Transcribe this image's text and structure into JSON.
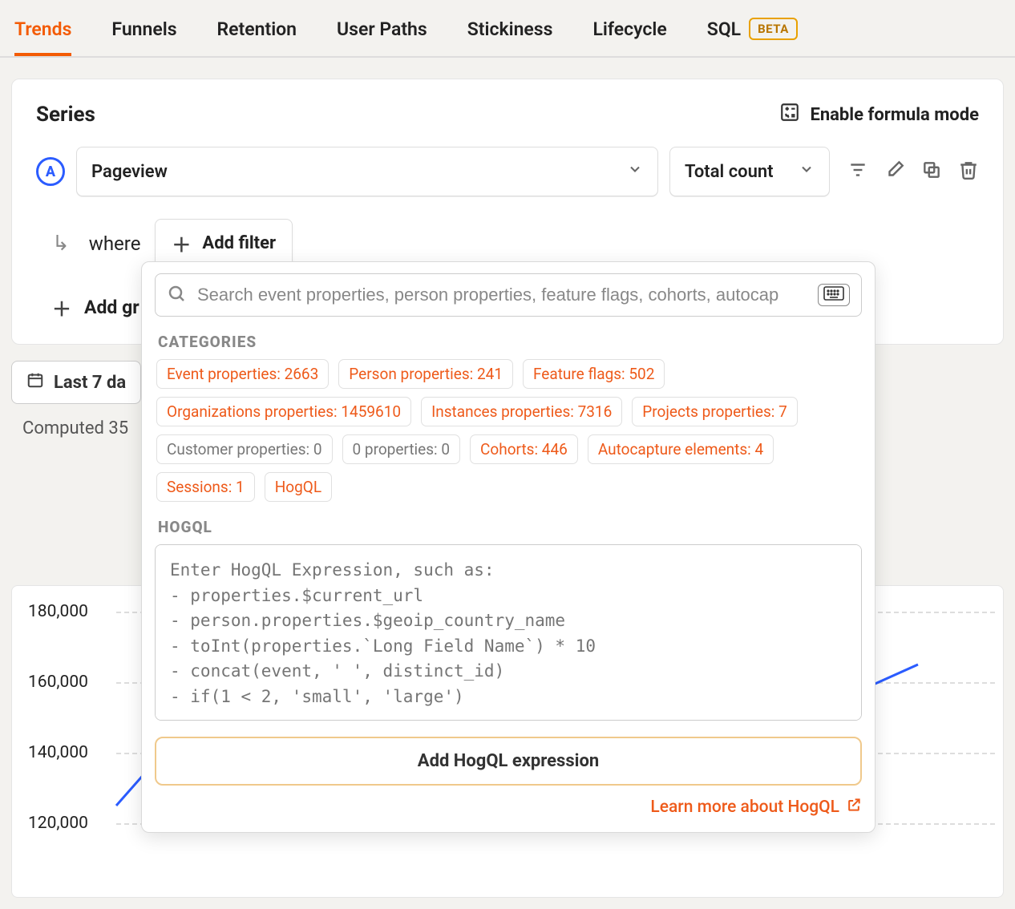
{
  "tabs": {
    "trends": "Trends",
    "funnels": "Funnels",
    "retention": "Retention",
    "user_paths": "User Paths",
    "stickiness": "Stickiness",
    "lifecycle": "Lifecycle",
    "sql": "SQL",
    "beta_badge": "BETA"
  },
  "series": {
    "title": "Series",
    "formula_toggle": "Enable formula mode",
    "badge_letter": "A",
    "event_label": "Pageview",
    "metric_label": "Total count",
    "where_label": "where",
    "add_filter_label": "Add filter",
    "add_graph_label": "Add gr"
  },
  "time": {
    "range_label": "Last 7 da",
    "computed_label": "Computed 35"
  },
  "popover": {
    "search_placeholder": "Search event properties, person properties, feature flags, cohorts, autocap",
    "categories_label": "CATEGORIES",
    "chips": [
      {
        "label": "Event properties: 2663",
        "muted": false
      },
      {
        "label": "Person properties: 241",
        "muted": false
      },
      {
        "label": "Feature flags: 502",
        "muted": false
      },
      {
        "label": "Organizations properties: 1459610",
        "muted": false
      },
      {
        "label": "Instances properties: 7316",
        "muted": false
      },
      {
        "label": "Projects properties: 7",
        "muted": false
      },
      {
        "label": "Customer properties: 0",
        "muted": true
      },
      {
        "label": "0 properties: 0",
        "muted": true
      },
      {
        "label": "Cohorts: 446",
        "muted": false
      },
      {
        "label": "Autocapture elements: 4",
        "muted": false
      },
      {
        "label": "Sessions: 1",
        "muted": false
      },
      {
        "label": "HogQL",
        "muted": false
      }
    ],
    "hogql_label": "HOGQL",
    "hogql_placeholder": "Enter HogQL Expression, such as:\n- properties.$current_url\n- person.properties.$geoip_country_name\n- toInt(properties.`Long Field Name`) * 10\n- concat(event, ' ', distinct_id)\n- if(1 < 2, 'small', 'large')",
    "add_hogql_label": "Add HogQL expression",
    "learn_more_label": "Learn more about HogQL"
  },
  "chart_data": {
    "type": "line",
    "ylabels": [
      "180,000",
      "160,000",
      "140,000",
      "120,000"
    ],
    "ylim": [
      120000,
      180000
    ],
    "x": [
      0,
      1,
      2,
      3,
      4,
      5,
      6
    ],
    "values": [
      125000,
      168000,
      162000,
      158000,
      160000,
      148000,
      165000
    ]
  }
}
